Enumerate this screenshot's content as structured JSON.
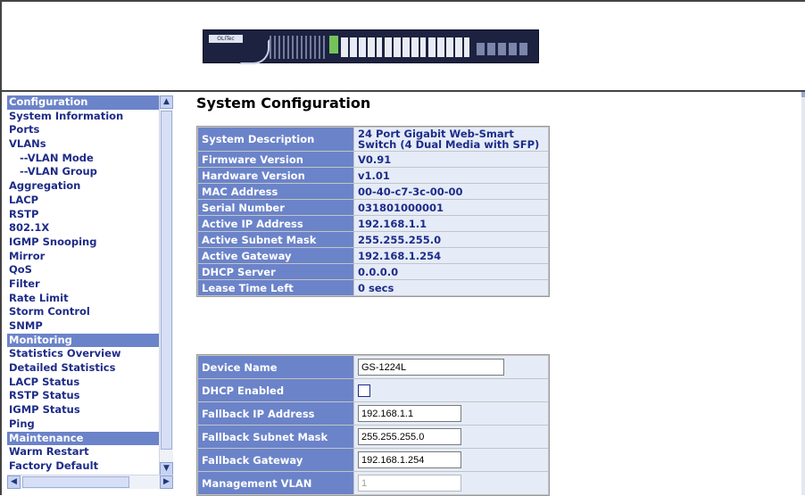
{
  "header": {
    "device_image": "switch-front-panel",
    "logo_text": "OLITec"
  },
  "nav": {
    "items": [
      {
        "label": "Configuration",
        "type": "section"
      },
      {
        "label": "System Information",
        "type": "item"
      },
      {
        "label": "Ports",
        "type": "item"
      },
      {
        "label": "VLANs",
        "type": "item"
      },
      {
        "label": "--VLAN Mode",
        "type": "sub"
      },
      {
        "label": "--VLAN Group",
        "type": "sub"
      },
      {
        "label": "Aggregation",
        "type": "item"
      },
      {
        "label": "LACP",
        "type": "item"
      },
      {
        "label": "RSTP",
        "type": "item"
      },
      {
        "label": "802.1X",
        "type": "item"
      },
      {
        "label": "IGMP Snooping",
        "type": "item"
      },
      {
        "label": "Mirror",
        "type": "item"
      },
      {
        "label": "QoS",
        "type": "item"
      },
      {
        "label": "Filter",
        "type": "item"
      },
      {
        "label": "Rate Limit",
        "type": "item"
      },
      {
        "label": "Storm Control",
        "type": "item"
      },
      {
        "label": "SNMP",
        "type": "item"
      },
      {
        "label": "Monitoring",
        "type": "section"
      },
      {
        "label": "Statistics Overview",
        "type": "item"
      },
      {
        "label": "Detailed Statistics",
        "type": "item"
      },
      {
        "label": "LACP Status",
        "type": "item"
      },
      {
        "label": "RSTP Status",
        "type": "item"
      },
      {
        "label": "IGMP Status",
        "type": "item"
      },
      {
        "label": "Ping",
        "type": "item"
      },
      {
        "label": "Maintenance",
        "type": "section"
      },
      {
        "label": "Warm Restart",
        "type": "item"
      },
      {
        "label": "Factory Default",
        "type": "item"
      }
    ],
    "scroll_up": "▲",
    "scroll_down": "▼",
    "scroll_left": "◀",
    "scroll_right": "▶"
  },
  "main": {
    "title": "System Configuration",
    "system_info": [
      {
        "label": "System Description",
        "value": "24 Port Gigabit Web-Smart Switch (4 Dual Media with SFP)"
      },
      {
        "label": "Firmware Version",
        "value": "V0.91"
      },
      {
        "label": "Hardware Version",
        "value": "v1.01"
      },
      {
        "label": "MAC Address",
        "value": "00-40-c7-3c-00-00"
      },
      {
        "label": "Serial Number",
        "value": "031801000001"
      },
      {
        "label": "Active IP Address",
        "value": "192.168.1.1"
      },
      {
        "label": "Active Subnet Mask",
        "value": "255.255.255.0"
      },
      {
        "label": "Active Gateway",
        "value": "192.168.1.254"
      },
      {
        "label": "DHCP Server",
        "value": "0.0.0.0"
      },
      {
        "label": "Lease Time Left",
        "value": "0 secs"
      }
    ],
    "device_settings": {
      "device_name_label": "Device Name",
      "device_name_value": "GS-1224L",
      "dhcp_label": "DHCP Enabled",
      "dhcp_checked": false,
      "fallback_ip_label": "Fallback IP Address",
      "fallback_ip_value": "192.168.1.1",
      "fallback_mask_label": "Fallback Subnet Mask",
      "fallback_mask_value": "255.255.255.0",
      "fallback_gw_label": "Fallback Gateway",
      "fallback_gw_value": "192.168.1.254",
      "mgmt_vlan_label": "Management VLAN",
      "mgmt_vlan_value": "1"
    }
  },
  "colors": {
    "nav_text": "#1e2c88",
    "section_bg": "#6b83c9",
    "value_bg": "#e5ecf8"
  }
}
